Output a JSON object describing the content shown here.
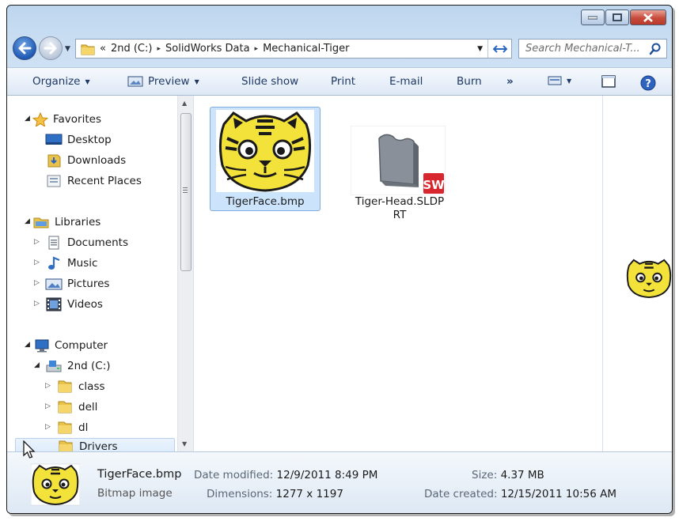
{
  "window": {
    "caption_buttons": [
      "minimize",
      "maximize",
      "close"
    ]
  },
  "address": {
    "overflow": "«",
    "crumbs": [
      "2nd (C:)",
      "SolidWorks Data",
      "Mechanical-Tiger"
    ],
    "separator": "▸"
  },
  "search": {
    "placeholder": "Search Mechanical-T..."
  },
  "toolbar": {
    "organize": "Organize",
    "preview": "Preview",
    "slideshow": "Slide show",
    "print": "Print",
    "email": "E-mail",
    "burn": "Burn",
    "more": "»"
  },
  "nav": {
    "favorites": "Favorites",
    "desktop": "Desktop",
    "downloads": "Downloads",
    "recent": "Recent Places",
    "libraries": "Libraries",
    "documents": "Documents",
    "music": "Music",
    "pictures": "Pictures",
    "videos": "Videos",
    "computer": "Computer",
    "drive": "2nd (C:)",
    "class": "class",
    "dell": "dell",
    "dl": "dl",
    "drivers": "Drivers"
  },
  "files": [
    {
      "name": "TigerFace.bmp",
      "icon": "tiger-face-thumbnail",
      "selected": true
    },
    {
      "name_line1": "Tiger-Head.SLDP",
      "name_line2": "RT",
      "icon": "solidworks-part-thumbnail",
      "badge": "SW",
      "selected": false
    }
  ],
  "details": {
    "name": "TigerFace.bmp",
    "type": "Bitmap image",
    "modified_label": "Date modified:",
    "modified_value": "12/9/2011 8:49 PM",
    "dimensions_label": "Dimensions:",
    "dimensions_value": "1277 x 1197",
    "size_label": "Size:",
    "size_value": "4.37 MB",
    "created_label": "Date created:",
    "created_value": "12/15/2011 10:56 AM"
  },
  "colors": {
    "selection": "#cce4fb",
    "toolbar_text": "#1e3966",
    "tiger_yellow": "#f2e23a",
    "solidworks_red": "#d8262f"
  }
}
